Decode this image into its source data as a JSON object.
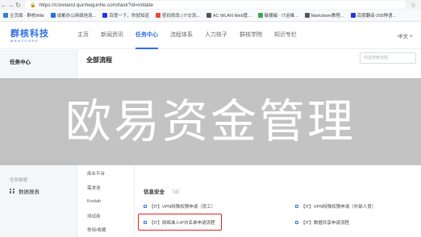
{
  "browser": {
    "url": "https://coreland.qunhequnhe.com/task?id=initiate",
    "bookmarks": [
      {
        "label": "主页面 · 群核Wiki",
        "color": "#3a7bd5"
      },
      {
        "label": "成都办公网络信息...",
        "color": "#2b6de5"
      },
      {
        "label": "百度一下，你就知道",
        "color": "#2932e1"
      },
      {
        "label": "密码修改 | IT交流...",
        "color": "#e34b3b"
      },
      {
        "label": "AC WLAN Web管...",
        "color": "#555555"
      },
      {
        "label": "敏捷磁 · IT运维...",
        "color": "#3aa757"
      },
      {
        "label": "Markdown教程...",
        "color": "#555555"
      },
      {
        "label": "百度翻译-200种语...",
        "color": "#2932e1"
      }
    ]
  },
  "header": {
    "logo": "群核科技",
    "logo_sub": "MANYCORE",
    "nav": [
      "主页",
      "新闻资讯",
      "任务中心",
      "流程体系",
      "人力核子",
      "群核学院",
      "知识专栏"
    ],
    "active_nav": "任务中心",
    "language": "中文"
  },
  "sidebar": {
    "title": "任务中心",
    "group": "任务数据",
    "items": [
      {
        "label": "数据报表"
      }
    ]
  },
  "main": {
    "title": "全部流程",
    "search_placeholder": "快速搜索流程",
    "categories": [
      "商业平台",
      "需求池",
      "Koolab",
      "测试用",
      "常用/收藏"
    ],
    "section": {
      "title": "信息安全",
      "count": "（4）"
    },
    "processes": [
      {
        "label": "【IT】VPN特殊权限申请（员工）"
      },
      {
        "label": "【IT】VPN特殊权限申请（外部人员）"
      },
      {
        "label": "【IT】网络准入IP白名单申请流程"
      },
      {
        "label": "【IT】数据共享申请流程"
      }
    ]
  },
  "banner": {
    "text": "欧易资金管理"
  },
  "colors": {
    "accent": "#2b6de5",
    "highlight": "#e0211d"
  }
}
